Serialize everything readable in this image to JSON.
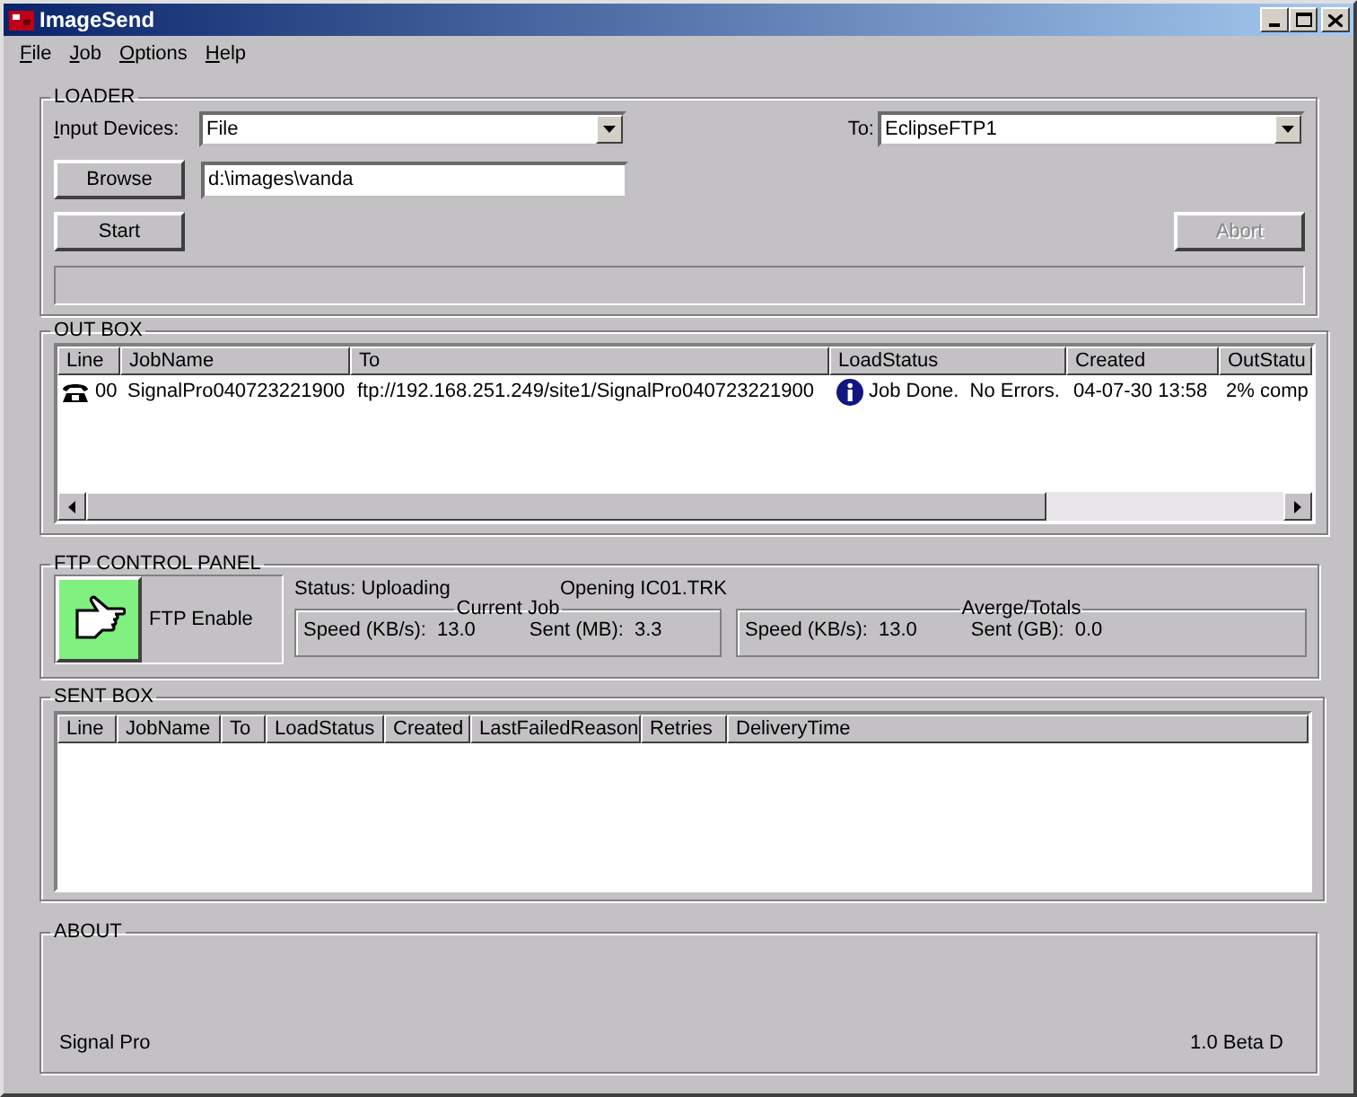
{
  "window": {
    "title": "ImageSend"
  },
  "menu": [
    {
      "label": "File"
    },
    {
      "label": "Job"
    },
    {
      "label": "Options"
    },
    {
      "label": "Help"
    }
  ],
  "loader": {
    "title": "LOADER",
    "input_devices": {
      "label": "Input Devices:",
      "value": "File"
    },
    "to": {
      "label": "To:",
      "value": "EclipseFTP1"
    },
    "path": "d:\\images\\vanda",
    "buttons": [
      {
        "label": "Browse",
        "disabled": false
      },
      {
        "label": "Start",
        "disabled": false
      },
      {
        "label": "Abort",
        "disabled": true
      }
    ],
    "progress": {
      "level": 0
    }
  },
  "outbox": {
    "title": "OUT BOX",
    "columns": [
      "Line",
      "JobName",
      "To",
      "LoadStatus",
      "Created",
      "OutStatu"
    ],
    "rows": [
      {
        "cells": [
          "00",
          "SignalPro040723221900",
          "ftp://192.168.251.249/site1/SignalPro040723221900",
          "Job Done.  No Errors.",
          "04-07-30 13:58",
          "2% comp"
        ]
      }
    ]
  },
  "ftp": {
    "title": "FTP CONTROL PANEL",
    "enable_button": {
      "label": "FTP Enable",
      "on": true
    },
    "status": "Status: Uploading",
    "message": "Opening IC01.TRK",
    "current_job": {
      "title": "Current Job",
      "speed_label": "Speed (KB/s):",
      "speed": "13.0",
      "sent_label": "Sent (MB):",
      "sent": "3.3"
    },
    "totals": {
      "title": "Averge/Totals",
      "speed_label": "Speed (KB/s):",
      "speed": "13.0",
      "sent_label": "Sent (GB):",
      "sent": "0.0"
    }
  },
  "sentbox": {
    "title": "SENT BOX",
    "columns": [
      "Line",
      "JobName",
      "To",
      "LoadStatus",
      "Created",
      "LastFailedReason",
      "Retries",
      "DeliveryTime"
    ]
  },
  "about": {
    "title": "ABOUT",
    "product": "Signal Pro",
    "version": "1.0 Beta D"
  }
}
